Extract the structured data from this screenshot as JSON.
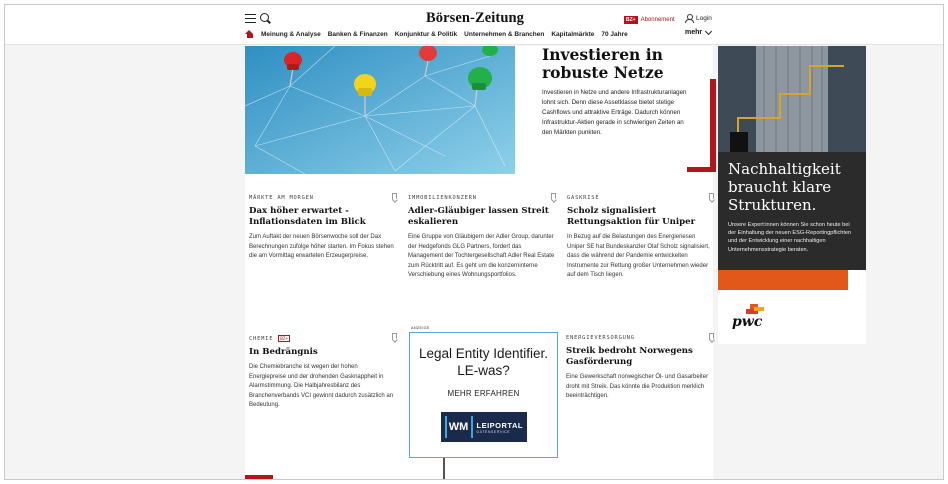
{
  "header": {
    "logo": "Börsen-Zeitung",
    "abo_badge": "BZ+",
    "abo_label": "Abonnement",
    "login_label": "Login",
    "nav_items": [
      "Meinung & Analyse",
      "Banken & Finanzen",
      "Konjunktur & Politik",
      "Unternehmen & Branchen",
      "Kapitalmärkte",
      "70 Jahre"
    ],
    "more_label": "mehr"
  },
  "hero": {
    "title": "Investieren in robuste Netze",
    "body": "Investieren in Netze und andere Infrastrukturanlagen lohnt sich. Denn diese Assetklasse bietet stetige Cashflows und attraktive Erträge. Dadurch können Infrastruktur-Aktien gerade in schwierigen Zeiten an den Märkten punkten."
  },
  "cards": [
    {
      "kicker": "MÄRKTE AM MORGEN",
      "title": "Dax höher erwartet - Inflationsdaten im Blick",
      "body": "Zum Auftakt der neuen Börsenwoche soll der Dax Berechnungen zufolge höher starten. Im Fokus stehen die am Vormittag erwarteten Erzeugerpreise."
    },
    {
      "kicker": "IMMOBILIENKONZERN",
      "title": "Adler-Gläubiger lassen Streit eskalieren",
      "body": "Eine Gruppe von Gläubigern der Adler Group, darunter der Hedgefonds GLG Partners, fordert das Management der Tochtergesellschaft Adler Real Estate zum Rücktritt auf. Es geht um die konzerninterne Verschiebung eines Wohnungsportfolios."
    },
    {
      "kicker": "GASKRISE",
      "title": "Scholz signalisiert Rettungsaktion für Uniper",
      "body": "In Bezug auf die Belastungen des Energieriesen Uniper SE hat Bundeskanzler Olaf Scholz signalisiert, dass die während der Pandemie entwickelten Instrumente zur Rettung großer Unternehmen wieder auf dem Tisch liegen."
    },
    {
      "kicker": "CHEMIE",
      "tag": "BZ+",
      "title": "In Bedrängnis",
      "body": "Die Chemiebranche ist wegen der hohen Energiepreise und der drohenden Gasknappheit in Alarmstimmung. Die Halbjahresbilanz des Branchenverbands VCI gewinnt dadurch zusätzlich an Bedeutung."
    },
    {
      "kicker": "ENERGIEVERSORGUNG",
      "title": "Streik bedroht Norwegens Gasförderung",
      "body": "Eine Gewerkschaft norwegischer Öl- und Gasarbeiter droht mit Streik. Das könnte die Produktion merklich beeinträchtigen."
    }
  ],
  "ad": {
    "label": "ANZEIGE",
    "title": "Legal Entity Identifier. LE-was?",
    "cta": "MEHR ERFAHREN",
    "logo_mark": "WM",
    "logo_name": "LEIPORTAL",
    "logo_sub": "DATENSERVICE"
  },
  "side_ad": {
    "title": "Nachhaltigkeit braucht klare Strukturen.",
    "body": "Unsere Expert:innen können Sie schon heute bei der Einhaltung der neuen ESG-Reportingpflichten und der Entwicklung einer nachhaltigen Unternehmensstrategie beraten.",
    "brand": "pwc"
  },
  "colors": {
    "accent": "#b4141b",
    "pwc_orange": "#e0591a",
    "ad_border": "#5aa6d3",
    "lei_navy": "#1b2a4a"
  }
}
